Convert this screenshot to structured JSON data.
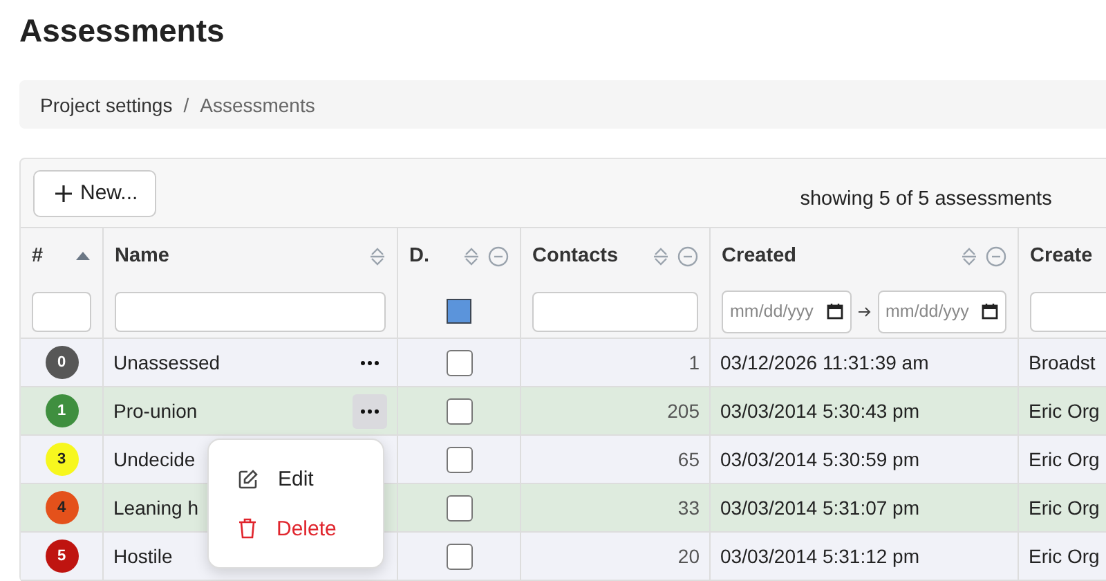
{
  "page_title": "Assessments",
  "breadcrumb_separator": "/",
  "breadcrumb": [
    {
      "label": "Project settings",
      "current": false
    },
    {
      "label": "Assessments",
      "current": true
    }
  ],
  "toolbar": {
    "new_button": "New...",
    "summary": "showing 5 of 5 assessments"
  },
  "columns": [
    {
      "label": "#",
      "sorted": true,
      "hideable": false,
      "kind": "text"
    },
    {
      "label": "Name",
      "sorted": false,
      "hideable": false,
      "kind": "text"
    },
    {
      "label": "D.",
      "sorted": false,
      "hideable": true,
      "kind": "color",
      "color": "#5b94db"
    },
    {
      "label": "Contacts",
      "sorted": false,
      "hideable": true,
      "kind": "text"
    },
    {
      "label": "Created",
      "sorted": false,
      "hideable": true,
      "kind": "daterange",
      "placeholders": [
        "mm/dd/yyy",
        "mm/dd/yyy"
      ]
    },
    {
      "label": "Create",
      "kind": "text"
    }
  ],
  "rows": [
    {
      "num": "0",
      "color": "#575757",
      "name": "Unassessed",
      "checked": false,
      "contacts": "1",
      "created": "03/12/2026 11:31:39 am",
      "created_by": "Broadst"
    },
    {
      "num": "1",
      "color": "#3f8f3f",
      "name": "Pro-union",
      "checked": false,
      "contacts": "205",
      "created": "03/03/2014 5:30:43 pm",
      "created_by": "Eric Org",
      "menu": [
        {
          "kind": "edit",
          "label": "Edit"
        },
        {
          "kind": "delete",
          "label": "Delete"
        }
      ]
    },
    {
      "num": "3",
      "color": "#f7f71e",
      "name": "Undecide",
      "checked": false,
      "contacts": "65",
      "created": "03/03/2014 5:30:59 pm",
      "created_by": "Eric Org"
    },
    {
      "num": "4",
      "color": "#e4511b",
      "name": "Leaning h",
      "checked": false,
      "contacts": "33",
      "created": "03/03/2014 5:31:07 pm",
      "created_by": "Eric Org"
    },
    {
      "num": "5",
      "color": "#bf1410",
      "name": "Hostile",
      "checked": false,
      "contacts": "20",
      "created": "03/03/2014 5:31:12 pm",
      "created_by": "Eric Org"
    }
  ]
}
